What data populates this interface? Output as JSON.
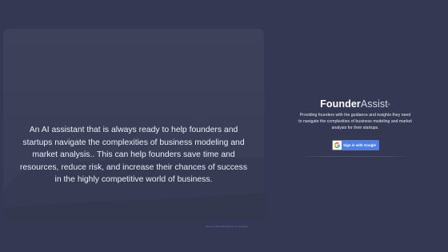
{
  "hero": {
    "description": "An AI assistant that is always ready to help founders and startups navigate the complexities of business modeling and market analysis.. This can help founders save time and resources, reduce risk, and increase their chances of success in the highly competitive world of business."
  },
  "credit": {
    "text": "Photo by Aleks Marinkovic on Unsplash"
  },
  "brand": {
    "name_strong": "Founder",
    "name_light": "Assist",
    "mark": "®"
  },
  "panel": {
    "tagline": "Providing founders with the guidance and insights they need to navigate the complexities of business modeling and market analysis for their startups.",
    "google_button_label": "Sign in with Google"
  },
  "colors": {
    "background": "#343852",
    "card": "#3b3f57",
    "google_blue": "#4a80e8",
    "credit_link": "#6b73c9"
  },
  "icons": {
    "google": "google-g-icon"
  }
}
